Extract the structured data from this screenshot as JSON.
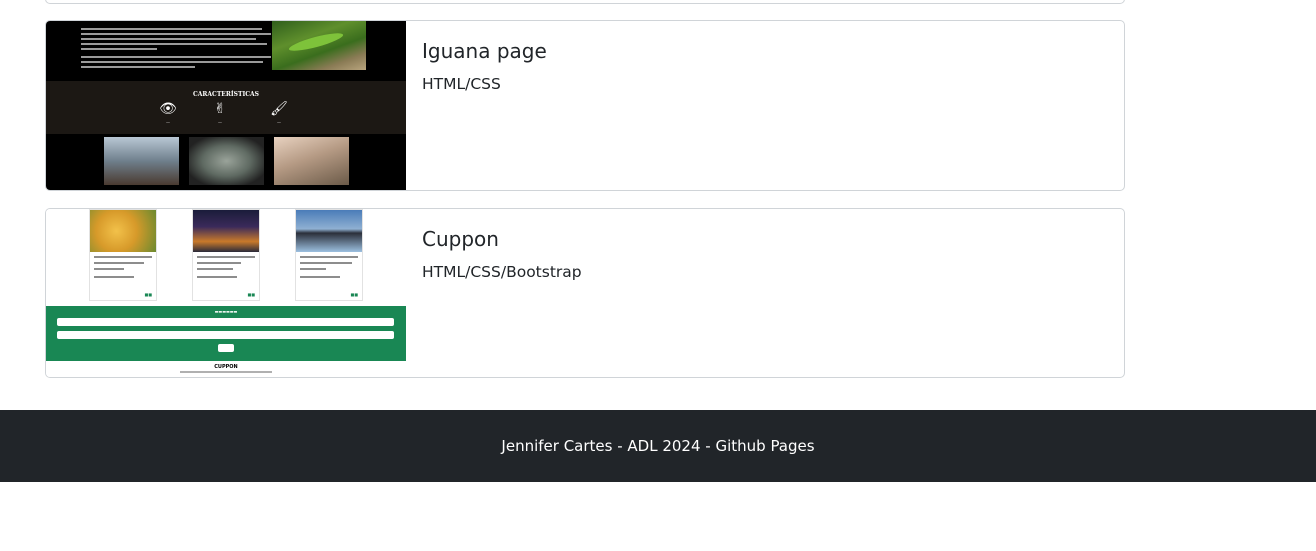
{
  "projects": [
    {
      "title": "Iguana page",
      "tech": "HTML/CSS"
    },
    {
      "title": "Cuppon",
      "tech": "HTML/CSS/Bootstrap"
    }
  ],
  "iguana_thumb": {
    "heading": "CARACTERÍSTICAS",
    "feature_icons": [
      "eye-icon",
      "hand-icon",
      "brush-icon"
    ]
  },
  "cuppon_thumb": {
    "brand": "CUPPON"
  },
  "footer": {
    "text": "Jennifer Cartes - ADL 2024 - Github Pages"
  },
  "colors": {
    "footer_bg": "#212529",
    "cuppon_green": "#198754",
    "card_border": "#d0d4d8"
  }
}
